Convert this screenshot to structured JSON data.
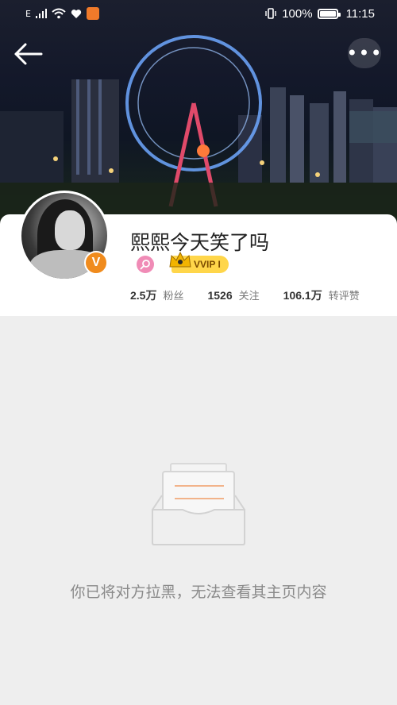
{
  "status_bar": {
    "network": "E",
    "battery": "100%",
    "time": "11:15"
  },
  "profile": {
    "username": "熙熙今天笑了吗",
    "vip_label": "VVIP I",
    "stats": [
      {
        "value": "2.5万",
        "label": "粉丝"
      },
      {
        "value": "1526",
        "label": "关注"
      },
      {
        "value": "106.1万",
        "label": "转评赞"
      }
    ]
  },
  "empty_state": {
    "message": "你已将对方拉黑，无法查看其主页内容"
  },
  "colors": {
    "verified_orange": "#f08b1d",
    "vip_gold": "#ffd64a",
    "pink_badge": "#f08bb6",
    "background": "#eeeeee"
  },
  "icons": [
    "back-arrow-icon",
    "more-icon",
    "verified-icon",
    "search-badge-icon",
    "crown-icon",
    "empty-box-icon"
  ]
}
